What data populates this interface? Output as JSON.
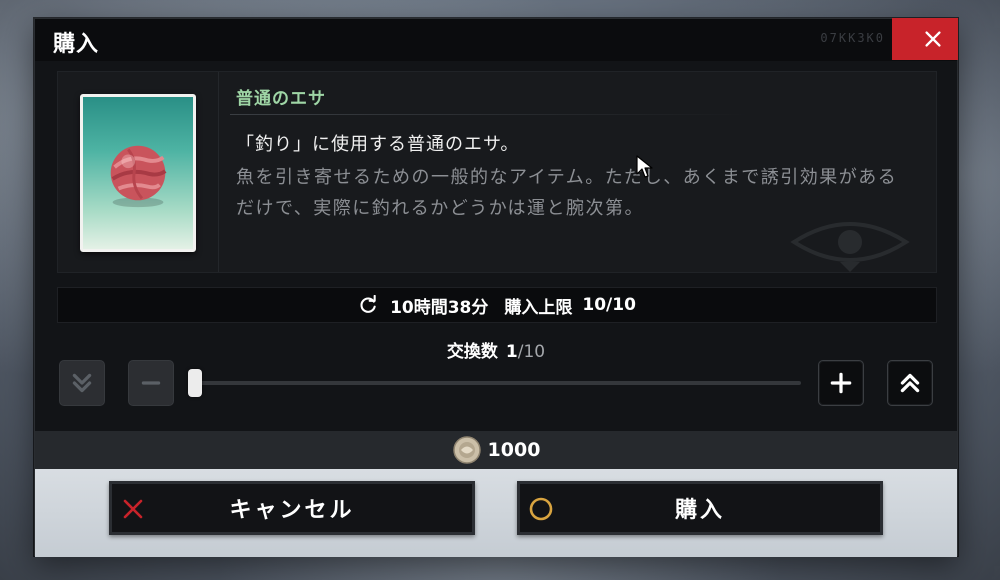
{
  "dialog": {
    "title": "購入",
    "code": "07KK3K0",
    "close_icon": "close-icon",
    "accent_color": "#c8232a"
  },
  "item": {
    "name": "普通のエサ",
    "name_color": "#9fd6a6",
    "description_main": "「釣り」に使用する普通のエサ。",
    "description_sub": "魚を引き寄せるための一般的なアイテム。ただし、あくまで誘引効果があるだけで、実際に釣れるかどうかは運と腕次第。",
    "icon": "bait-ball-icon"
  },
  "timer": {
    "icon": "refresh-icon",
    "remaining": "10時間38分",
    "limit_label": "購入上限",
    "limit_value": "10/10"
  },
  "quantity": {
    "label": "交換数",
    "current": "1",
    "max": "/10",
    "slider_value": 1,
    "slider_max": 10,
    "decrease_all_icon": "double-chevron-down-icon",
    "decrease_icon": "minus-icon",
    "increase_icon": "plus-icon",
    "increase_all_icon": "double-chevron-up-icon"
  },
  "price": {
    "icon": "coin-icon",
    "value": "1000"
  },
  "buttons": {
    "cancel_label": "キャンセル",
    "cancel_icon": "cross-icon",
    "cancel_icon_color": "#c8232a",
    "buy_label": "購入",
    "buy_icon": "circle-icon",
    "buy_icon_color": "#d9a440"
  }
}
